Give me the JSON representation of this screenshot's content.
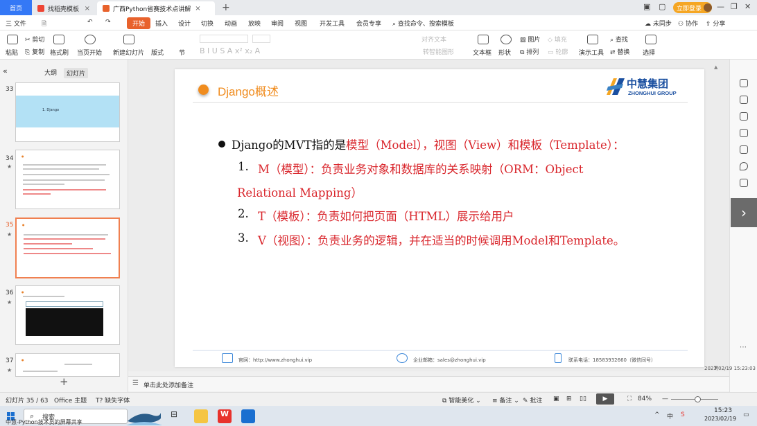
{
  "window": {
    "tabs": [
      {
        "label": "首页"
      },
      {
        "label": "找稻壳模板"
      },
      {
        "label": "广西Python省赛技术点讲解"
      }
    ],
    "login_label": "立即登录"
  },
  "menu": {
    "file": "三 文件",
    "items": [
      "开始",
      "插入",
      "设计",
      "切换",
      "动画",
      "放映",
      "审阅",
      "视图",
      "开发工具",
      "会员专享"
    ],
    "search_placeholder": "查找命令、搜索模板",
    "sync": "未同步",
    "collab": "协作",
    "share": "分享"
  },
  "ribbon": {
    "paste": "粘贴",
    "cut": "剪切",
    "copy": "复制",
    "format_painter": "格式刷",
    "from_current": "当页开始",
    "new_slide": "新建幻灯片",
    "layout": "版式",
    "section": "节",
    "font_row": "B I U S A x² x₂ A",
    "align_text": "对齐文本",
    "smartart": "转智能图形",
    "textbox": "文本框",
    "shapes": "形状",
    "picture": "图片",
    "fill": "填充",
    "arrange": "排列",
    "outline": "轮廓",
    "slideshow_tools": "演示工具",
    "find": "查找",
    "replace": "替换",
    "select": "选择"
  },
  "left_panel": {
    "tabs": [
      "大纲",
      "幻灯片"
    ],
    "thumbnails": [
      {
        "number": "33",
        "text": "1. Django"
      },
      {
        "number": "34",
        "text": ""
      },
      {
        "number": "35",
        "text": ""
      },
      {
        "number": "36",
        "text": ""
      },
      {
        "number": "37",
        "text": ""
      }
    ],
    "add_slide": "+"
  },
  "slide": {
    "title": "Django概述",
    "logo_cn": "中慧集团",
    "logo_en": "ZHONGHUI GROUP",
    "intro": {
      "prefix": "Django的MVT指的是",
      "highlight": "模型（Model），视图（View）和模板（Template）："
    },
    "items": [
      {
        "num": "1.",
        "text_line1": "M（模型）：负责业务对象和数据库的关系映射（ORM：Object",
        "text_line2": "Relational Mapping）"
      },
      {
        "num": "2.",
        "text": "T（模板）：负责如何把页面（HTML）展示给用户"
      },
      {
        "num": "3.",
        "text": "V（视图）：负责业务的逻辑，并在适当的时候调用Model和Template。"
      }
    ],
    "footer": {
      "website": "官网：http://www.zhonghui.vip",
      "email": "企业邮箱：sales@zhonghui.vip",
      "phone": "联系电话：18583932660（微信同号）"
    }
  },
  "notes": {
    "placeholder": "单击此处添加备注"
  },
  "status": {
    "slide_count": "幻灯片 35 / 63",
    "theme": "Office 主题",
    "missing_font": "缺失字体",
    "beautify": "智能美化",
    "notes": "备注",
    "comments": "批注",
    "zoom": "84%"
  },
  "taskbar": {
    "search": "搜索",
    "time": "15:23",
    "date": "2023/02/19",
    "ime": "中"
  },
  "overlay": {
    "recorder_caption": "中慧-Python技术员的屏幕共享",
    "timestamp": "2023/02/19 15:23:03"
  },
  "colors": {
    "accent_orange": "#f08c1e",
    "active_tab_red": "#e8622c",
    "text_red": "#d9262c",
    "logo_blue": "#1a4fa0",
    "home_tab_blue": "#3478f6"
  }
}
